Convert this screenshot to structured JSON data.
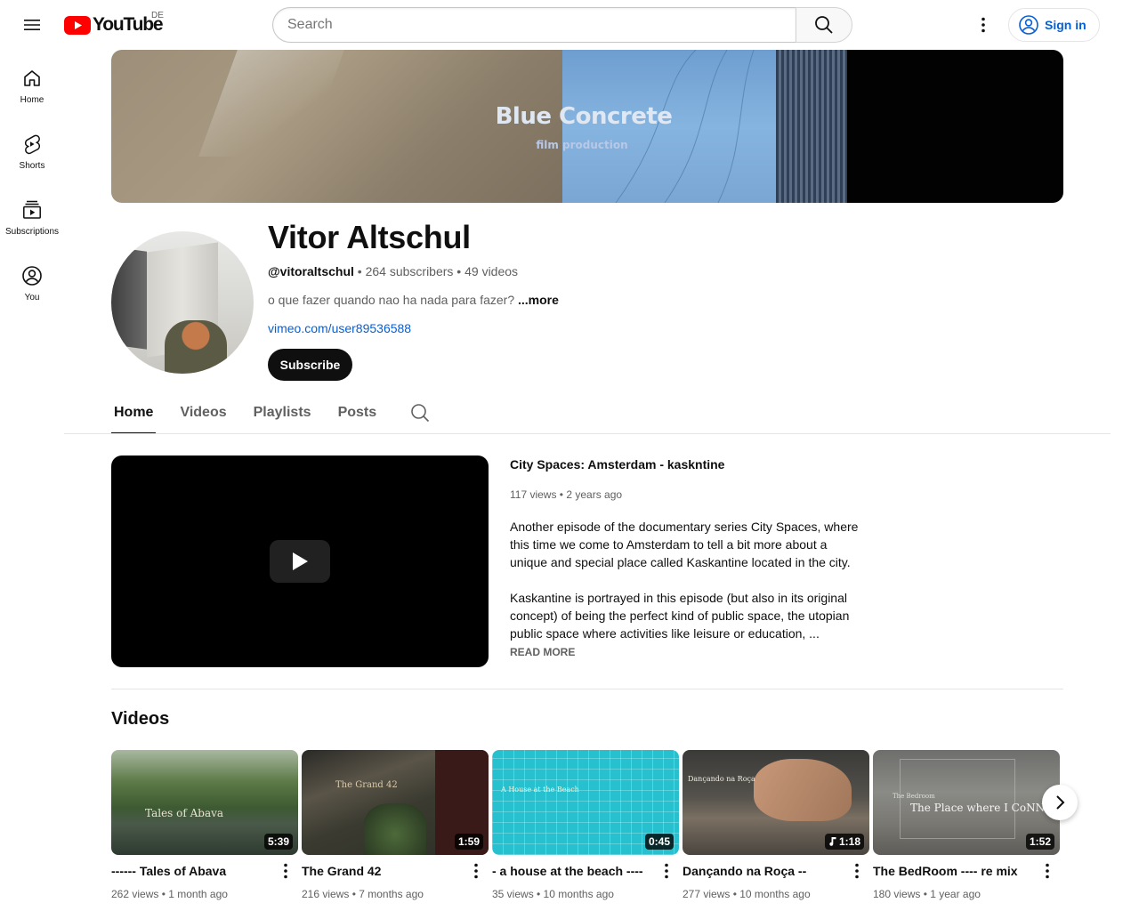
{
  "header": {
    "logo_text": "YouTube",
    "country_code": "DE",
    "search_placeholder": "Search",
    "sign_in_label": "Sign in"
  },
  "guide": {
    "items": [
      {
        "label": "Home",
        "icon": "home-icon"
      },
      {
        "label": "Shorts",
        "icon": "shorts-icon"
      },
      {
        "label": "Subscriptions",
        "icon": "subscriptions-icon"
      },
      {
        "label": "You",
        "icon": "you-icon"
      }
    ]
  },
  "banner": {
    "title": "Blue Concrete",
    "subtitle": "film production"
  },
  "channel": {
    "name": "Vitor Altschul",
    "handle": "@vitoraltschul",
    "subscribers": "264 subscribers",
    "videos": "49 videos",
    "separator": " • ",
    "description": "o que fazer quando nao ha nada para fazer?",
    "more_label": "...more",
    "link": "vimeo.com/user89536588",
    "subscribe_label": "Subscribe"
  },
  "tabs": [
    {
      "label": "Home",
      "active": true
    },
    {
      "label": "Videos",
      "active": false
    },
    {
      "label": "Playlists",
      "active": false
    },
    {
      "label": "Posts",
      "active": false
    }
  ],
  "featured": {
    "title": "City Spaces: Amsterdam - kaskntine",
    "views": "117 views",
    "age": "2 years ago",
    "meta": "117 views • 2 years ago",
    "description_p1": "Another episode of the documentary series City Spaces, where this time we come to Amsterdam to tell a bit more about a unique and special place called Kaskantine located in the city.",
    "description_p2": "Kaskantine is portrayed in this episode (but also in its original concept) of being the perfect kind of public space, the utopian public space where activities like leisure or education, ...",
    "read_more": "READ MORE"
  },
  "shelf": {
    "title": "Videos",
    "videos": [
      {
        "title": "------ Tales of Abava",
        "thumb_text": "Tales of Abava",
        "duration": "5:39",
        "meta": "262 views • 1 month ago",
        "music": false
      },
      {
        "title": "The Grand 42",
        "thumb_text": "The Grand 42",
        "duration": "1:59",
        "meta": "216 views • 7 months ago",
        "music": false
      },
      {
        "title": "- a house at the beach ----",
        "thumb_text": "A House at the Beach",
        "duration": "0:45",
        "meta": "35 views • 10 months ago",
        "music": false
      },
      {
        "title": "Dançando na Roça --",
        "thumb_text": "Dançando na Roça",
        "duration": "1:18",
        "meta": "277 views • 10 months ago",
        "music": true
      },
      {
        "title": "The BedRoom ---- re mix",
        "thumb_text": "The Place where I CoNN",
        "thumb_text_small": "The Bedroom",
        "duration": "1:52",
        "meta": "180 views • 1 year ago",
        "music": false
      }
    ]
  }
}
